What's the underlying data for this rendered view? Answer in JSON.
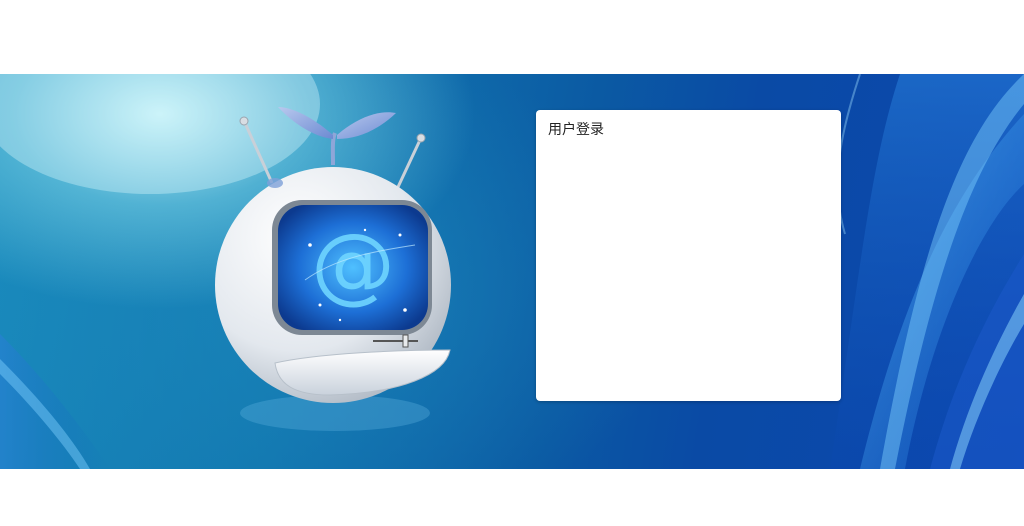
{
  "login_panel": {
    "title": "用户登录"
  },
  "colors": {
    "banner_blue": "#0b5aa3",
    "banner_cyan": "#1a8bbd",
    "panel_bg": "#ffffff"
  },
  "icons": {
    "mascot": "email-tv-mascot-illustration",
    "at_symbol": "at-sign-icon"
  }
}
